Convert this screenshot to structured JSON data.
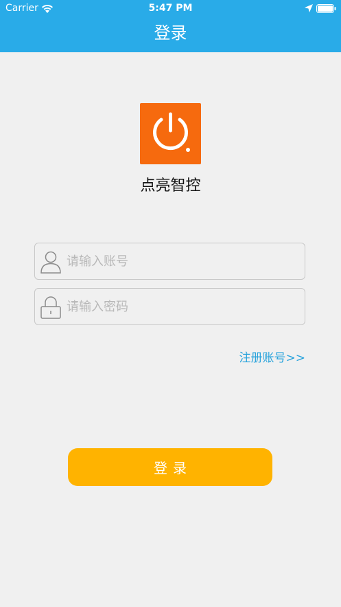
{
  "status_bar": {
    "carrier": "Carrier",
    "time": "5:47 PM"
  },
  "header": {
    "title": "登录",
    "background_color": "#29abe8"
  },
  "logo": {
    "icon": "power-icon",
    "background_color": "#f66a0e"
  },
  "app_name": "点亮智控",
  "form": {
    "username_placeholder": "请输入账号",
    "password_placeholder": "请输入密码",
    "username_icon": "user-icon",
    "password_icon": "lock-icon"
  },
  "register_link": "注册账号>>",
  "login_button": {
    "label": "登录",
    "color": "#ffb300"
  }
}
